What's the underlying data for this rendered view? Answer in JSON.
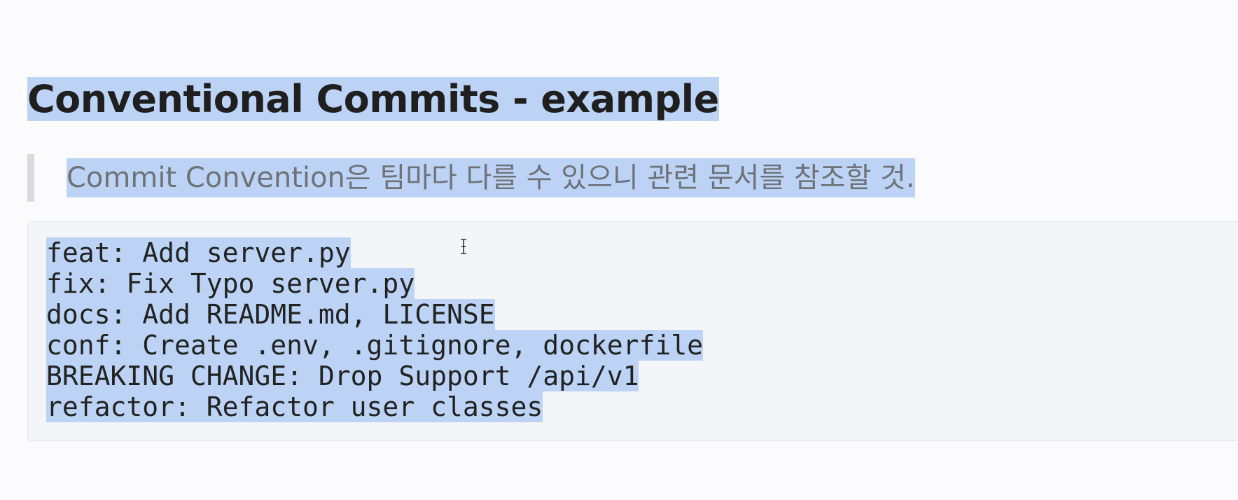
{
  "heading": "Conventional Commits - example",
  "note": "Commit Convention은 팀마다 다를 수 있으니 관련 문서를 참조할 것.",
  "code_lines": [
    "feat: Add server.py",
    "fix: Fix Typo server.py",
    "docs: Add README.md, LICENSE",
    "conf: Create .env, .gitignore, dockerfile",
    "BREAKING CHANGE: Drop Support /api/v1",
    "refactor: Refactor user classes"
  ],
  "colors": {
    "selection": "#bcd3f5",
    "background": "#fbfbfd",
    "code_background": "#f4f5f8",
    "quote_bar": "#d9dadc",
    "quote_text": "#6f7278"
  },
  "icons": {
    "cursor": "text-cursor-icon"
  }
}
